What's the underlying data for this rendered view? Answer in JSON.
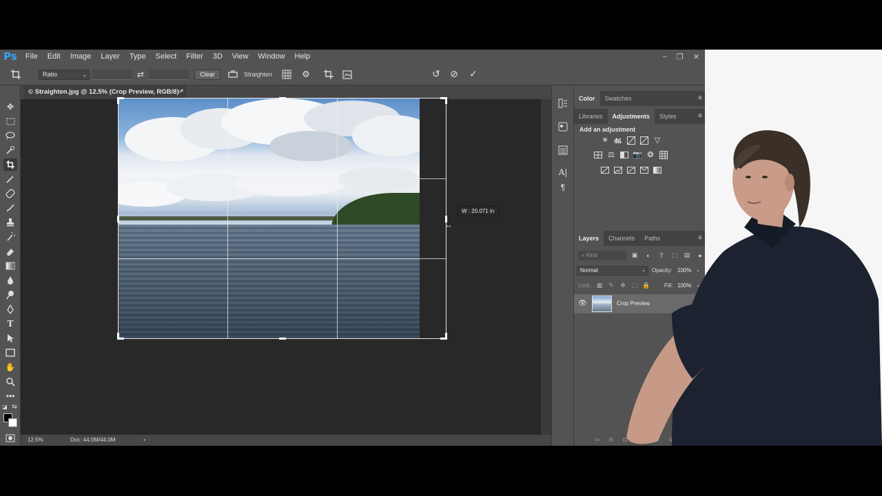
{
  "app": {
    "logo": "Ps",
    "menus": [
      "File",
      "Edit",
      "Image",
      "Layer",
      "Type",
      "Select",
      "Filter",
      "3D",
      "View",
      "Window",
      "Help"
    ],
    "window_controls": [
      "–",
      "❐",
      "✕"
    ]
  },
  "options_bar": {
    "ratio_label": "Ratio",
    "clear_label": "Clear",
    "straighten_label": "Straighten"
  },
  "document": {
    "tab_title": "© Straighten.jpg @ 12.5% (Crop Preview, RGB/8) *",
    "tab_close": "×",
    "crop_tooltip": "W :  20.071 in"
  },
  "status_bar": {
    "zoom": "12.5%",
    "doc_size": "Doc: 44.0M/44.0M",
    "arrow": "›"
  },
  "panels": {
    "color_tabs": [
      {
        "label": "Color",
        "active": true
      },
      {
        "label": "Swatches",
        "active": false
      }
    ],
    "adjust_tabs": [
      {
        "label": "Libraries",
        "active": false
      },
      {
        "label": "Adjustments",
        "active": true
      },
      {
        "label": "Styles",
        "active": false
      }
    ],
    "add_adjustment": "Add an adjustment",
    "layers_tabs": [
      {
        "label": "Layers",
        "active": true
      },
      {
        "label": "Channels",
        "active": false
      },
      {
        "label": "Paths",
        "active": false
      }
    ],
    "filter_placeholder": "Kind",
    "blend_mode": "Normal",
    "opacity_label": "Opacity:",
    "opacity_value": "100%",
    "lock_label": "Lock:",
    "fill_label": "Fill:",
    "fill_value": "100%",
    "layer_name": "Crop Preview",
    "menu_icon": "≡"
  },
  "colors": {
    "ui_dark": "#535353",
    "canvas": "#282828",
    "accent": "#31a8ff"
  }
}
